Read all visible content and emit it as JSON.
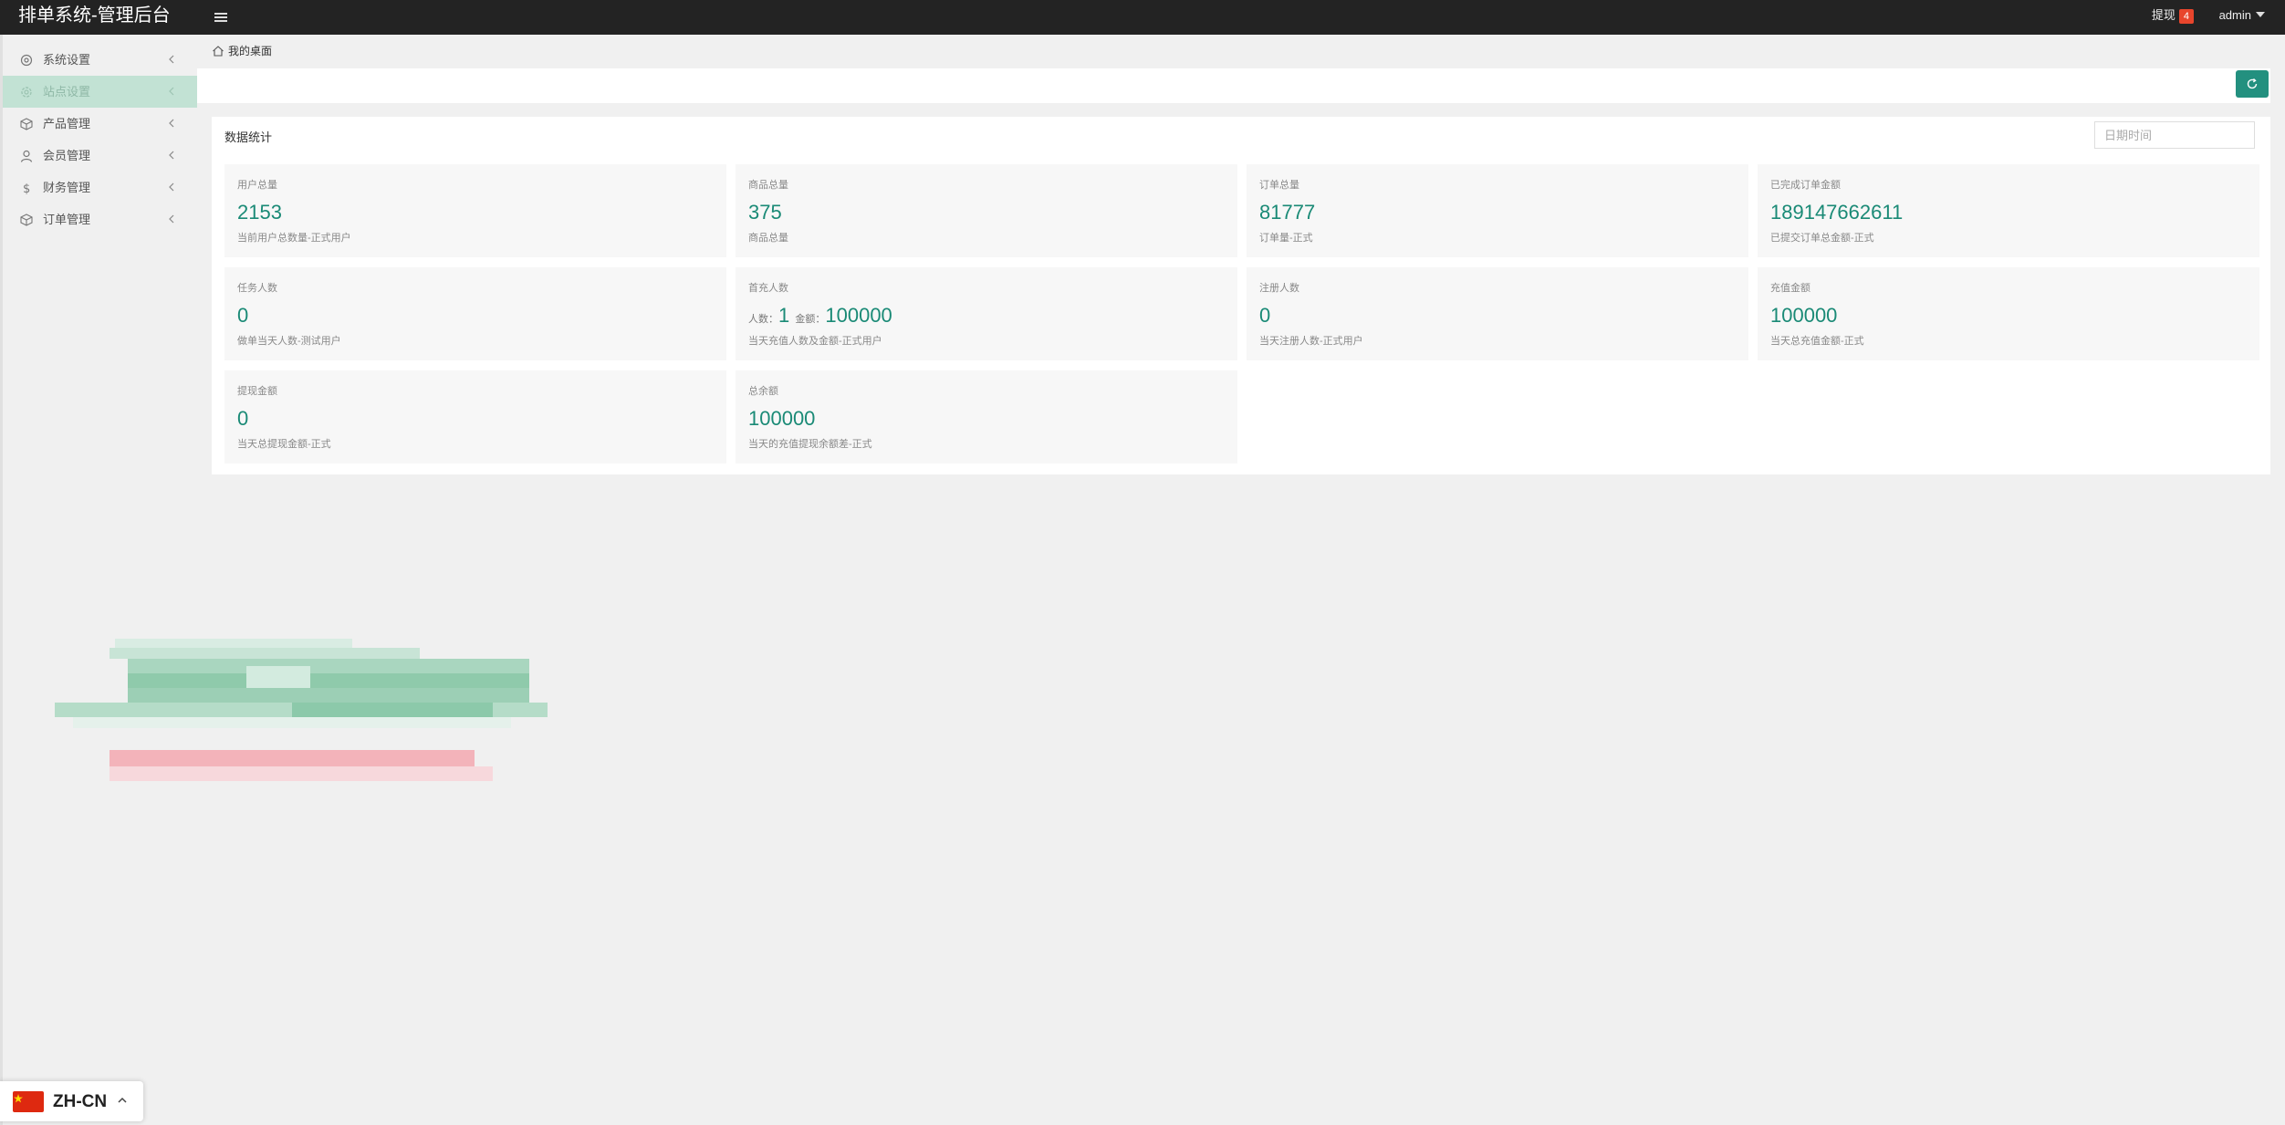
{
  "app": {
    "title": "排单系统-管理后台"
  },
  "topbar": {
    "withdraw_label": "提现",
    "withdraw_count": "4",
    "user": "admin"
  },
  "sidebar": {
    "items": [
      {
        "label": "系统设置",
        "icon": "gear-icon",
        "active": false
      },
      {
        "label": "站点设置",
        "icon": "cog-icon",
        "active": true
      },
      {
        "label": "产品管理",
        "icon": "box-icon",
        "active": false
      },
      {
        "label": "会员管理",
        "icon": "user-icon",
        "active": false
      },
      {
        "label": "财务管理",
        "icon": "dollar-icon",
        "active": false
      },
      {
        "label": "订单管理",
        "icon": "package-icon",
        "active": false
      }
    ]
  },
  "breadcrumb": {
    "home": "我的桌面"
  },
  "stats": {
    "title": "数据统计",
    "date_placeholder": "日期时间",
    "cards": [
      {
        "label": "用户总量",
        "value": "2153",
        "desc": "当前用户总数量-正式用户"
      },
      {
        "label": "商品总量",
        "value": "375",
        "desc": "商品总量"
      },
      {
        "label": "订单总量",
        "value": "81777",
        "desc": "订单量-正式"
      },
      {
        "label": "已完成订单金额",
        "value": "189147662611",
        "desc": "已提交订单总金额-正式"
      },
      {
        "label": "任务人数",
        "value": "0",
        "desc": "做单当天人数-测试用户"
      },
      {
        "label": "首充人数",
        "count_label": "人数：",
        "count_value": "1",
        "amount_label": "金额：",
        "amount_value": "100000",
        "desc": "当天充值人数及金额-正式用户"
      },
      {
        "label": "注册人数",
        "value": "0",
        "desc": "当天注册人数-正式用户"
      },
      {
        "label": "充值金额",
        "value": "100000",
        "desc": "当天总充值金额-正式"
      },
      {
        "label": "提现金额",
        "value": "0",
        "desc": "当天总提现金额-正式"
      },
      {
        "label": "总余额",
        "value": "100000",
        "desc": "当天的充值提现余额差-正式"
      }
    ]
  },
  "language": {
    "label": "ZH-CN"
  },
  "colors": {
    "accent": "#23907f",
    "value_text": "#1a8a76",
    "topbar_bg": "#232323",
    "active_menu_bg": "#c2e2d4",
    "badge": "#e8452c",
    "flag": "#de2910"
  }
}
